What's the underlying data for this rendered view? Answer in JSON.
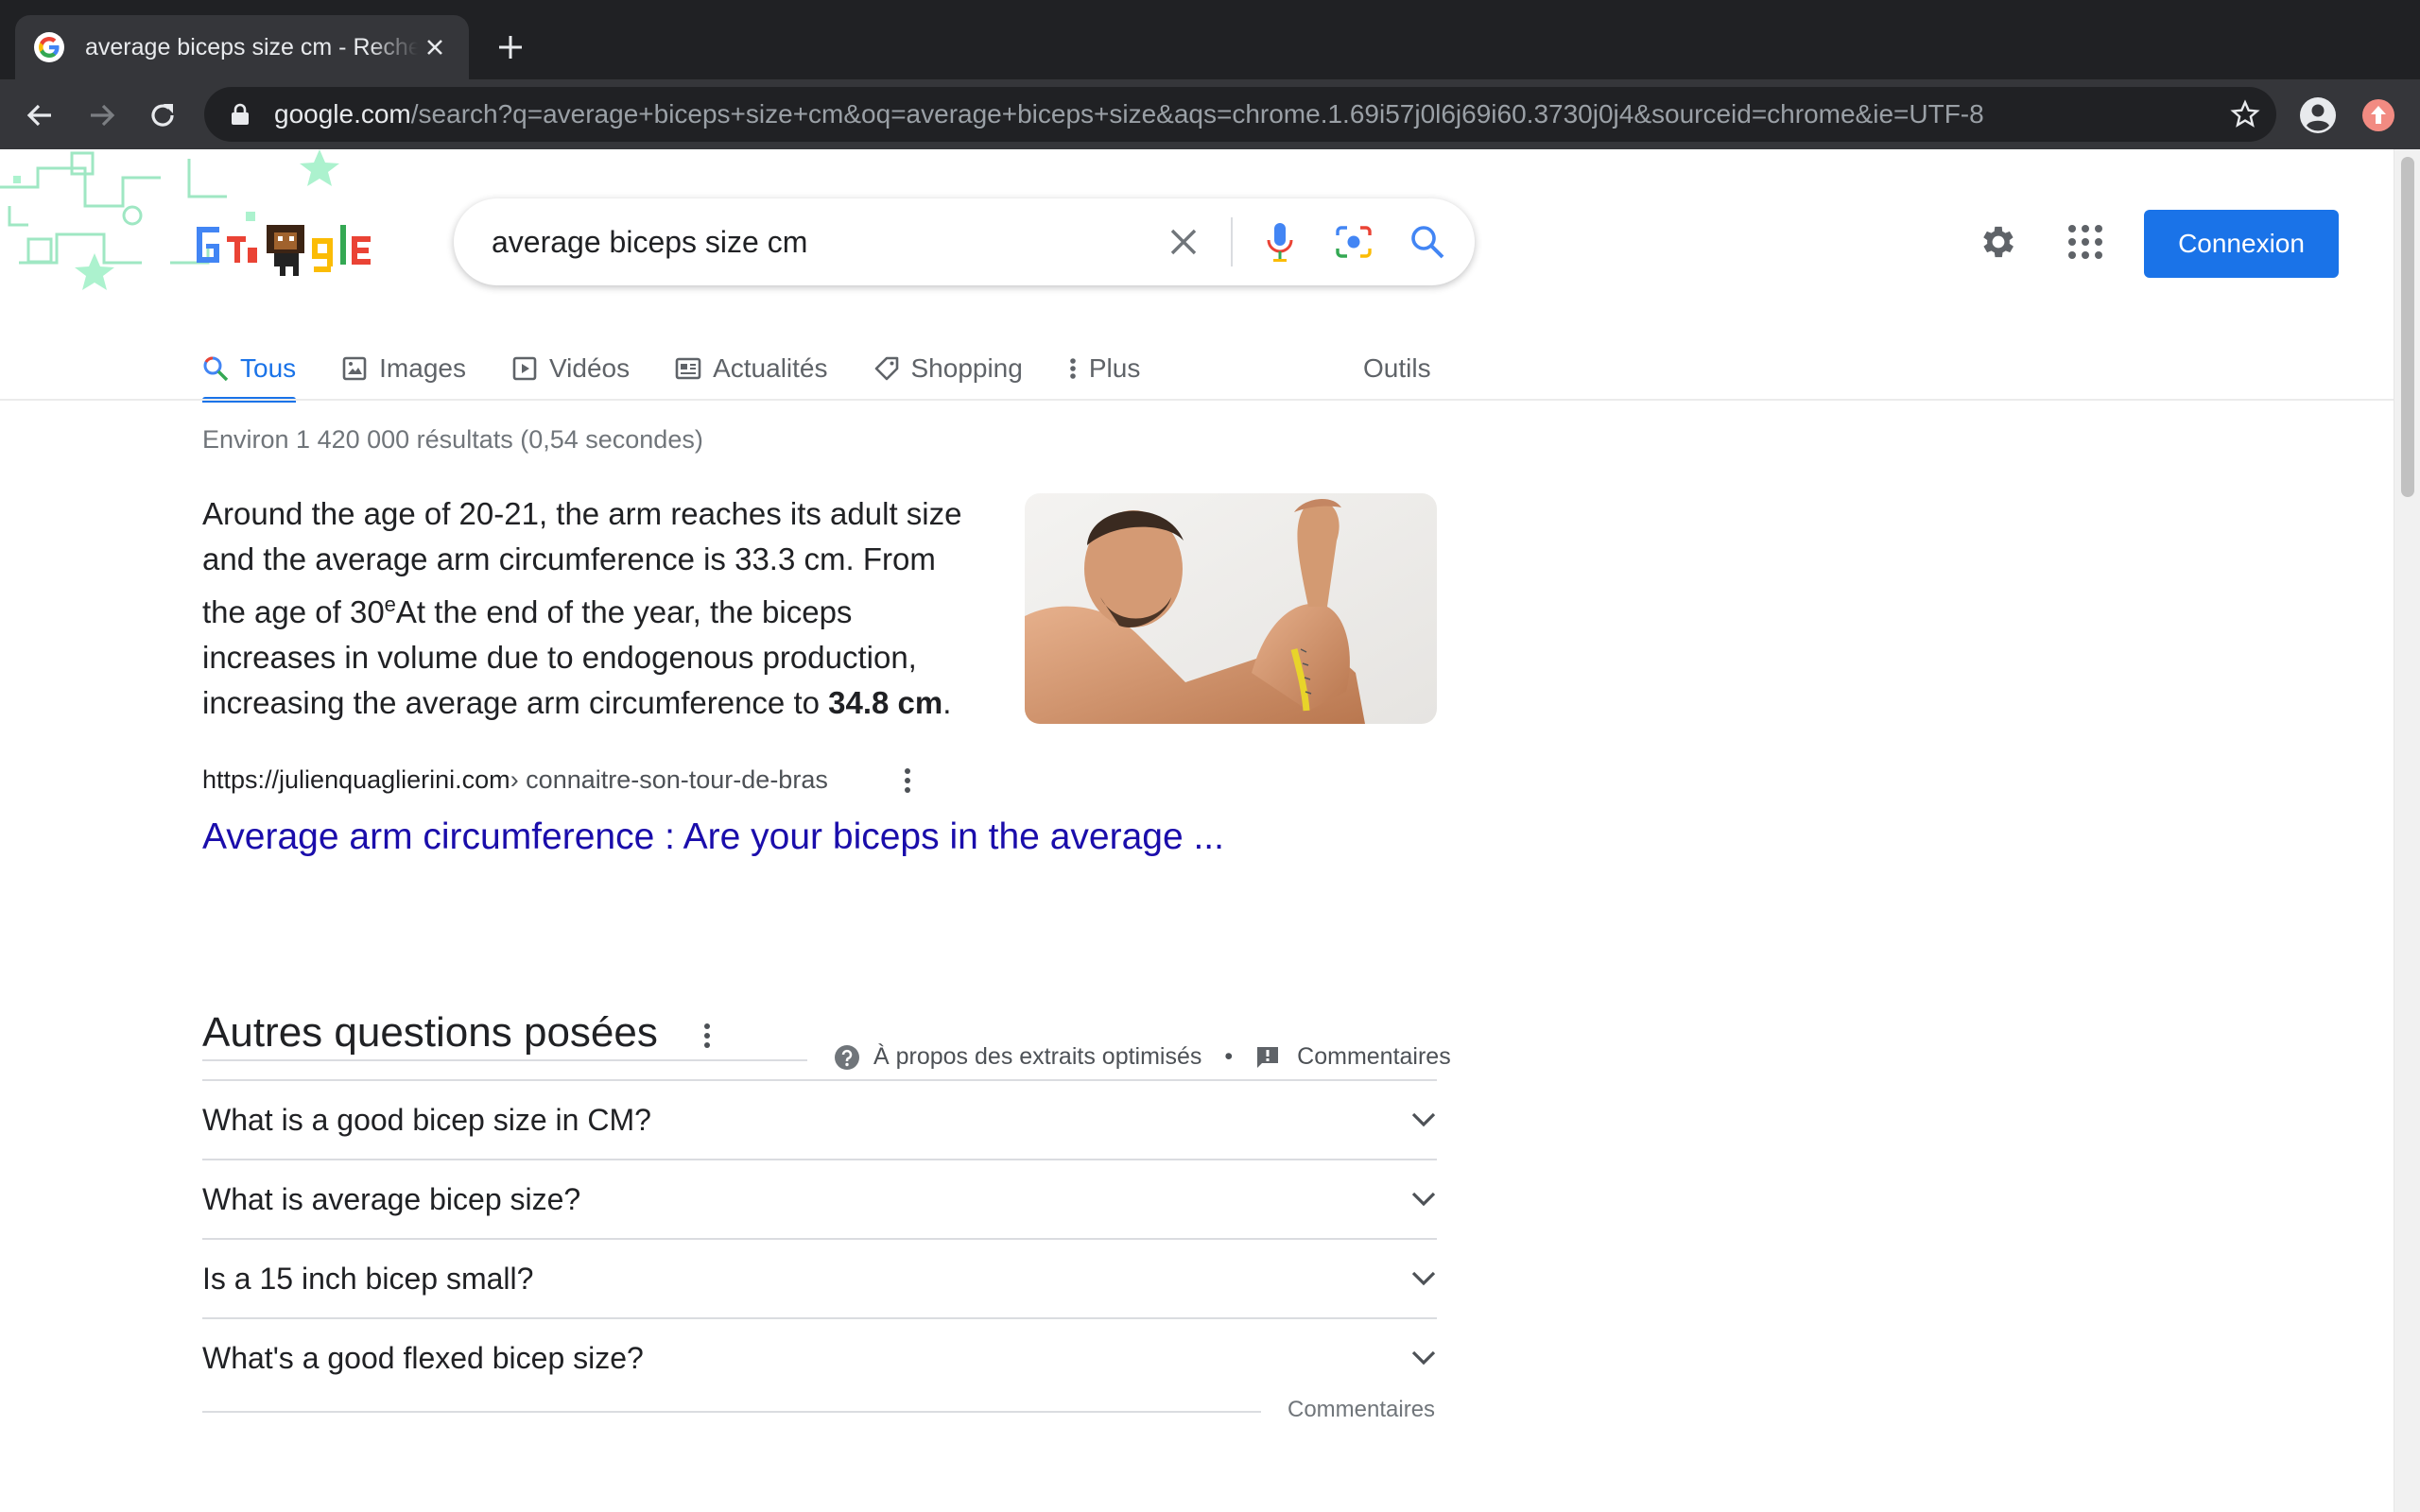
{
  "browser": {
    "tab_title": "average biceps size cm - Recherche Google",
    "url_host": "google.com",
    "url_path": "/search?q=average+biceps+size+cm&oq=average+biceps+size&aqs=chrome.1.69i57j0l6j69i60.3730j0j4&sourceid=chrome&ie=UTF-8"
  },
  "search": {
    "query": "average biceps size cm",
    "signin_label": "Connexion"
  },
  "tabs": {
    "all": "Tous",
    "images": "Images",
    "videos": "Vidéos",
    "news": "Actualités",
    "shopping": "Shopping",
    "more": "Plus",
    "tools": "Outils"
  },
  "results": {
    "stats": "Environ 1 420 000 résultats (0,54 secondes)"
  },
  "featured_snippet": {
    "text_part1": "Around the age of 20-21, the arm reaches its adult size and the average arm circumference is 33.3 cm. From the age of 30",
    "superscript": "e",
    "text_part2": "At the end of the year, the biceps increases in volume due to endogenous production, increasing the average arm circumference to ",
    "text_bold": "34.8 cm",
    "text_end": ".",
    "cite_domain": "https://julienquaglierini.com",
    "cite_path": " › connaitre-son-tour-de-bras",
    "title": "Average arm circumference : Are your biceps in the average ...",
    "about_label": "À propos des extraits optimisés",
    "separator": "•",
    "feedback_label": "Commentaires"
  },
  "people_also_ask": {
    "title": "Autres questions posées",
    "questions": [
      "What is a good bicep size in CM?",
      "What is average bicep size?",
      "Is a 15 inch bicep small?",
      "What's a good flexed bicep size?"
    ],
    "feedback_label": "Commentaires"
  },
  "colors": {
    "accent": "#1a73e8",
    "link": "#1a0dab",
    "chrome_dark": "#202124"
  }
}
